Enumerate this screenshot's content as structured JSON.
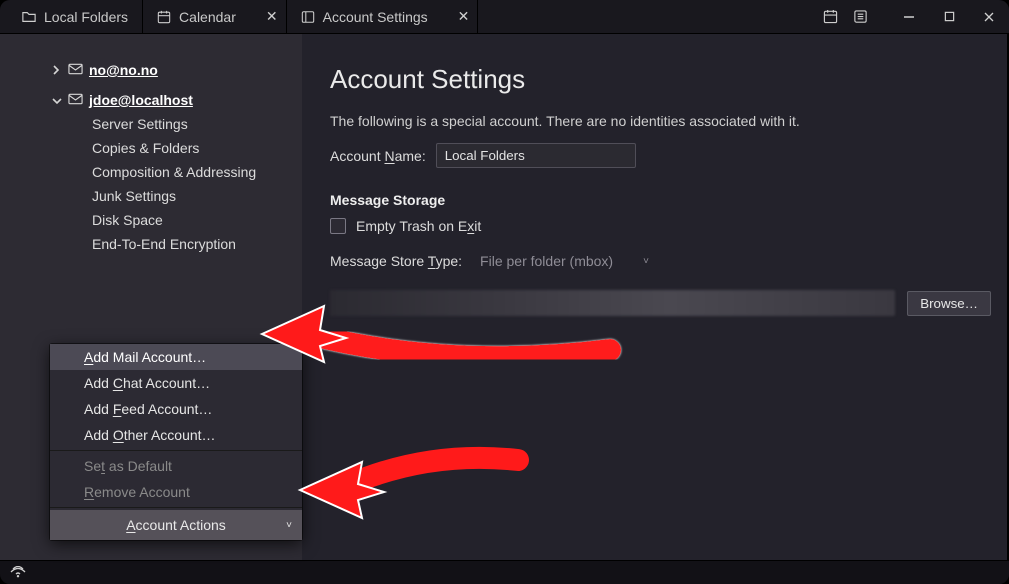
{
  "tabs": {
    "local_folders": "Local Folders",
    "calendar": "Calendar",
    "account_settings": "Account Settings"
  },
  "sidebar": {
    "accounts": [
      {
        "email": "no@no.no",
        "expanded": false
      },
      {
        "email": "jdoe@localhost",
        "expanded": true
      }
    ],
    "tree_items": [
      "Server Settings",
      "Copies & Folders",
      "Composition & Addressing",
      "Junk Settings",
      "Disk Space",
      "End-To-End Encryption"
    ],
    "account_actions_label": "Account Actions"
  },
  "account_actions_menu": {
    "add_mail": "Add Mail Account…",
    "add_chat": "Add Chat Account…",
    "add_feed": "Add Feed Account…",
    "add_other": "Add Other Account…",
    "set_default": "Set as Default",
    "remove": "Remove Account"
  },
  "main": {
    "title": "Account Settings",
    "description": "The following is a special account. There are no identities associated with it.",
    "account_name_label": "Account Name:",
    "account_name_value": "Local Folders",
    "storage_heading": "Message Storage",
    "empty_trash_label": "Empty Trash on Exit",
    "store_type_label": "Message Store Type:",
    "store_type_value": "File per folder (mbox)",
    "browse_label": "Browse…"
  }
}
